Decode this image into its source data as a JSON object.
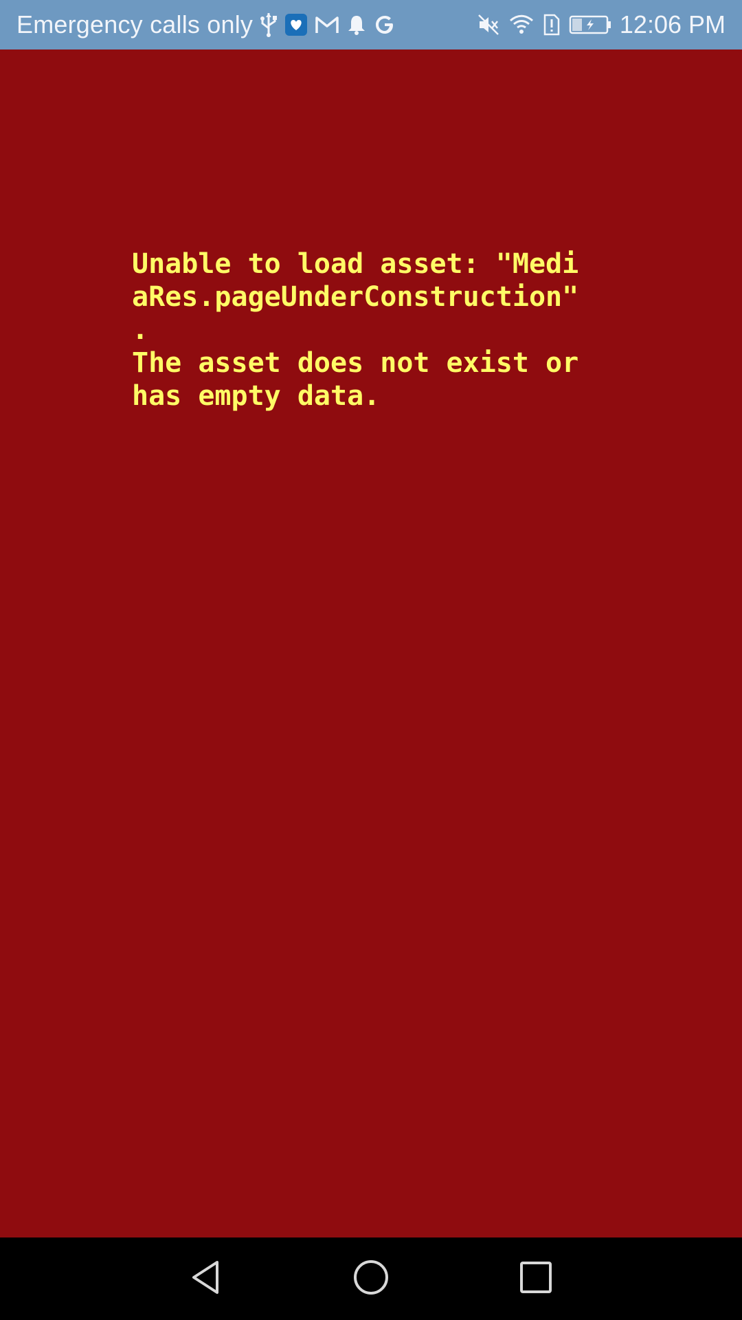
{
  "status_bar": {
    "carrier_text": "Emergency calls only",
    "time": "12:06 PM",
    "left_icons": [
      "usb-icon",
      "app-notification-icon",
      "gmail-icon",
      "bell-icon",
      "google-icon"
    ],
    "right_icons": [
      "mute-icon",
      "wifi-icon",
      "sim-alert-icon",
      "battery-charging-icon"
    ],
    "background_color": "#6e99c1"
  },
  "error": {
    "lines": [
      "Unable to load asset: \"Medi",
      "aRes.pageUnderConstruction\"",
      ".",
      "The asset does not exist or",
      "has empty data."
    ],
    "text_color": "#fffb66",
    "background_color": "#8f0c0f"
  },
  "nav_bar": {
    "buttons": [
      "back-icon",
      "home-icon",
      "recents-icon"
    ],
    "background_color": "#000000"
  }
}
